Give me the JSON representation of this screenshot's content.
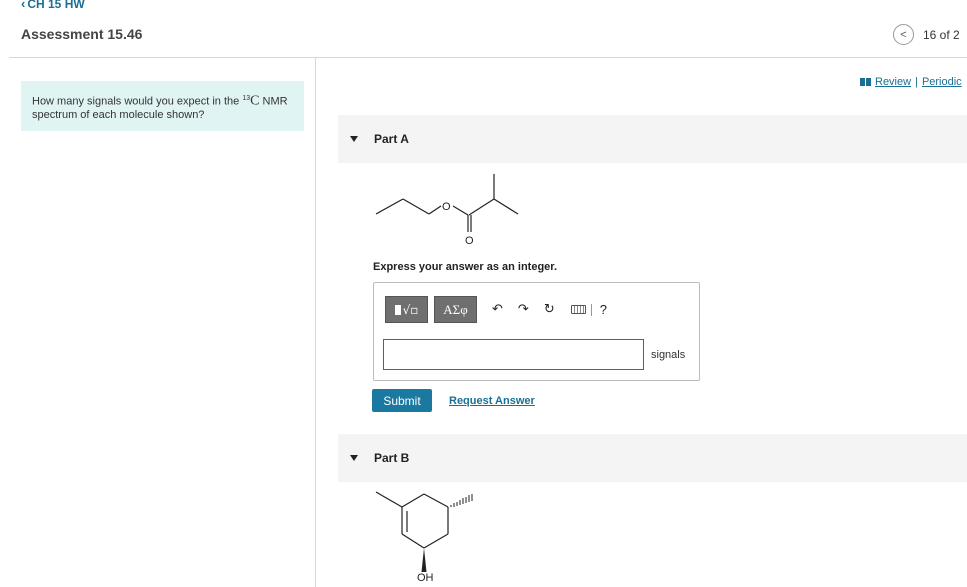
{
  "header": {
    "back_link": "CH 15 HW",
    "title": "Assessment 15.46",
    "position": "16 of 2"
  },
  "question": {
    "text_before": "How many signals would you expect in the",
    "isotope_mass": "13",
    "isotope_symbol": "C",
    "text_after": "NMR spectrum of each molecule shown?"
  },
  "links": {
    "review": "Review",
    "separator": "|",
    "periodic": "Periodic"
  },
  "partA": {
    "title": "Part A",
    "molecule_atom_labels": [
      "O",
      "O"
    ],
    "instruction": "Express your answer as an integer.",
    "toolbar": {
      "greek_label": "ΑΣφ",
      "undo_glyph": "↶",
      "redo_glyph": "↷",
      "reset_glyph": "↻",
      "help_label": "?"
    },
    "input_value": "",
    "unit": "signals",
    "submit_label": "Submit",
    "request_label": "Request Answer"
  },
  "partB": {
    "title": "Part B",
    "molecule_atom_labels": [
      "OH"
    ]
  },
  "colors": {
    "accent": "#1a79a0",
    "link": "#1a6f94",
    "question_bg": "#e1f4f4",
    "part_header_bg": "#f4f4f4"
  }
}
